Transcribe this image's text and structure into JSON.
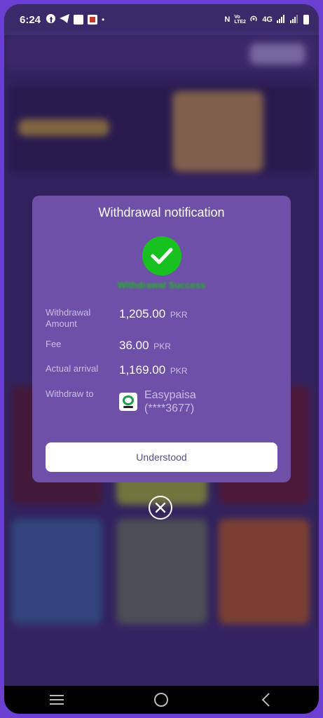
{
  "status_bar": {
    "time": "6:24",
    "network": "4G",
    "volte": "Vo LTE2",
    "icons": [
      "facebook-icon",
      "telegram-icon",
      "app-badge-icon",
      "app-badge-red-icon",
      "dot-icon",
      "nfc-icon",
      "hotspot-icon",
      "signal-icon",
      "signal-icon-2",
      "battery-icon"
    ]
  },
  "modal": {
    "title": "Withdrawal notification",
    "success_text": "Withdrawal Success",
    "rows": [
      {
        "label": "Withdrawal Amount",
        "value": "1,205.00",
        "unit": "PKR"
      },
      {
        "label": "Fee",
        "value": "36.00",
        "unit": "PKR"
      },
      {
        "label": "Actual arrival",
        "value": "1,169.00",
        "unit": "PKR"
      }
    ],
    "withdraw_to": {
      "label": "Withdraw to",
      "method": "Easypaisa",
      "account": "(****3677)",
      "icon": "easypaisa-logo-icon"
    },
    "button_label": "Understood"
  },
  "colors": {
    "modal_bg": "#6e50a8",
    "success_green": "#18c020",
    "accent": "#6a3fd1"
  }
}
